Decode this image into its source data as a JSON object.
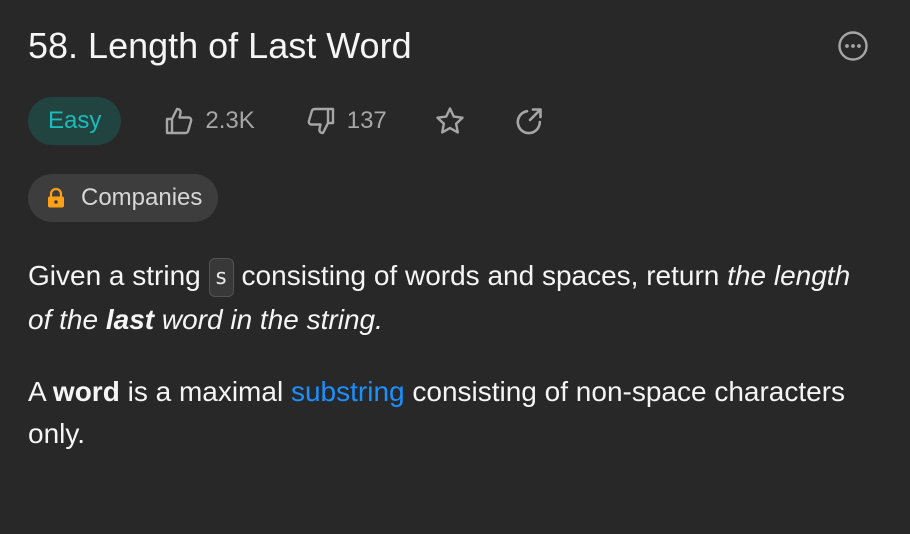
{
  "problem": {
    "title": "58. Length of Last Word",
    "difficulty": "Easy",
    "likes": "2.3K",
    "dislikes": "137",
    "companies_label": "Companies"
  },
  "description": {
    "p1_a": "Given a string ",
    "p1_code": "s",
    "p1_b": " consisting of words and spaces, return ",
    "p1_em1": "the length of the ",
    "p1_strong": "last",
    "p1_em2": " word in the string.",
    "p2_a": "A ",
    "p2_strong": "word",
    "p2_b": " is a maximal ",
    "p2_link": "substring",
    "p2_c": " consisting of non-space characters only."
  },
  "icons": {
    "more": "more-options-icon",
    "like": "thumbs-up-icon",
    "dislike": "thumbs-down-icon",
    "star": "star-icon",
    "share": "share-icon",
    "lock": "lock-icon"
  },
  "colors": {
    "background": "#282828",
    "easy_text": "#1cbaba",
    "easy_bg": "#214440",
    "link": "#1a90ff",
    "lock": "#ffa116"
  }
}
